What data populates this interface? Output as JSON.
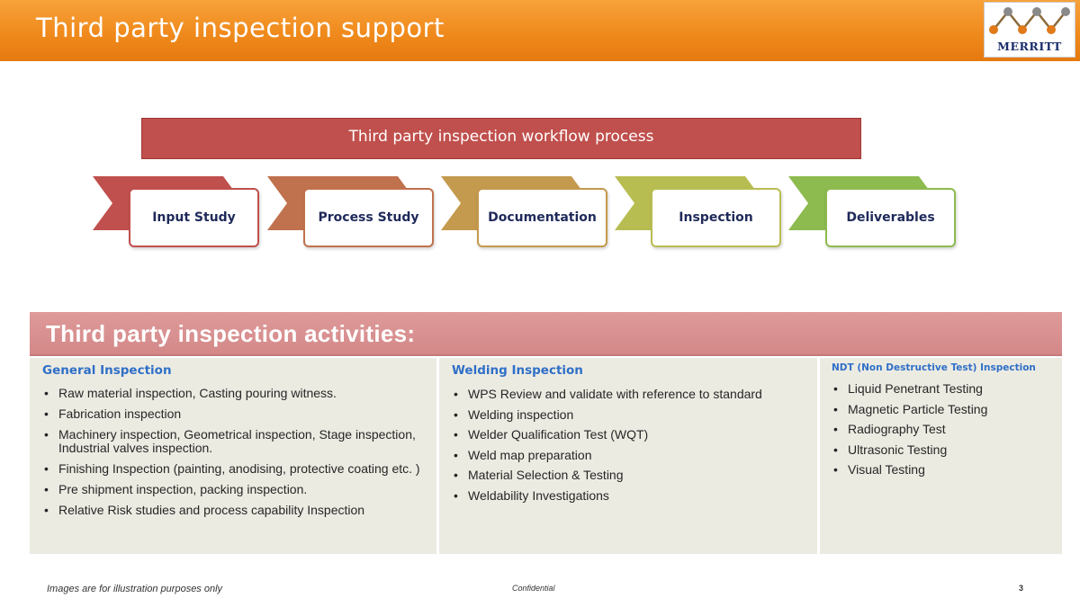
{
  "header": {
    "title": "Third party inspection support",
    "logo_text": "MERRITT"
  },
  "workflow": {
    "title": "Third party inspection workflow process",
    "steps": [
      {
        "label": "Input Study",
        "color": "#c0504d"
      },
      {
        "label": "Process Study",
        "color": "#c0714d"
      },
      {
        "label": "Documentation",
        "color": "#c49a4e"
      },
      {
        "label": "Inspection",
        "color": "#b8bd52"
      },
      {
        "label": "Deliverables",
        "color": "#8dbb4f"
      }
    ]
  },
  "activities": {
    "title": "Third party inspection activities:",
    "columns": [
      {
        "heading": "General Inspection",
        "items": [
          "Raw material inspection, Casting  pouring witness.",
          "Fabrication inspection",
          "Machinery  inspection, Geometrical inspection, Stage inspection, Industrial valves inspection.",
          "Finishing Inspection (painting, anodising, protective coating etc. )",
          "Pre shipment inspection, packing inspection.",
          "Relative Risk studies and process capability Inspection"
        ]
      },
      {
        "heading": "Welding Inspection",
        "items": [
          "WPS Review and validate with  reference to standard",
          "Welding inspection",
          "Welder Qualification Test (WQT)",
          "Weld map preparation",
          "Material Selection & Testing",
          "Weldability Investigations"
        ]
      },
      {
        "heading": "NDT (Non Destructive Test)  Inspection",
        "items": [
          "Liquid Penetrant Testing",
          "Magnetic Particle Testing",
          "Radiography Test",
          "Ultrasonic Testing",
          "Visual Testing"
        ]
      }
    ]
  },
  "footer": {
    "disclaimer": "Images are for illustration purposes only",
    "confidential": "Confidential",
    "page_number": "3"
  },
  "colors": {
    "header_orange": "#f08a1c",
    "workflow_bar": "#c0504d",
    "activities_band": "#d99494",
    "column_bg": "#ecebe2",
    "heading_blue": "#2f6fc7"
  }
}
